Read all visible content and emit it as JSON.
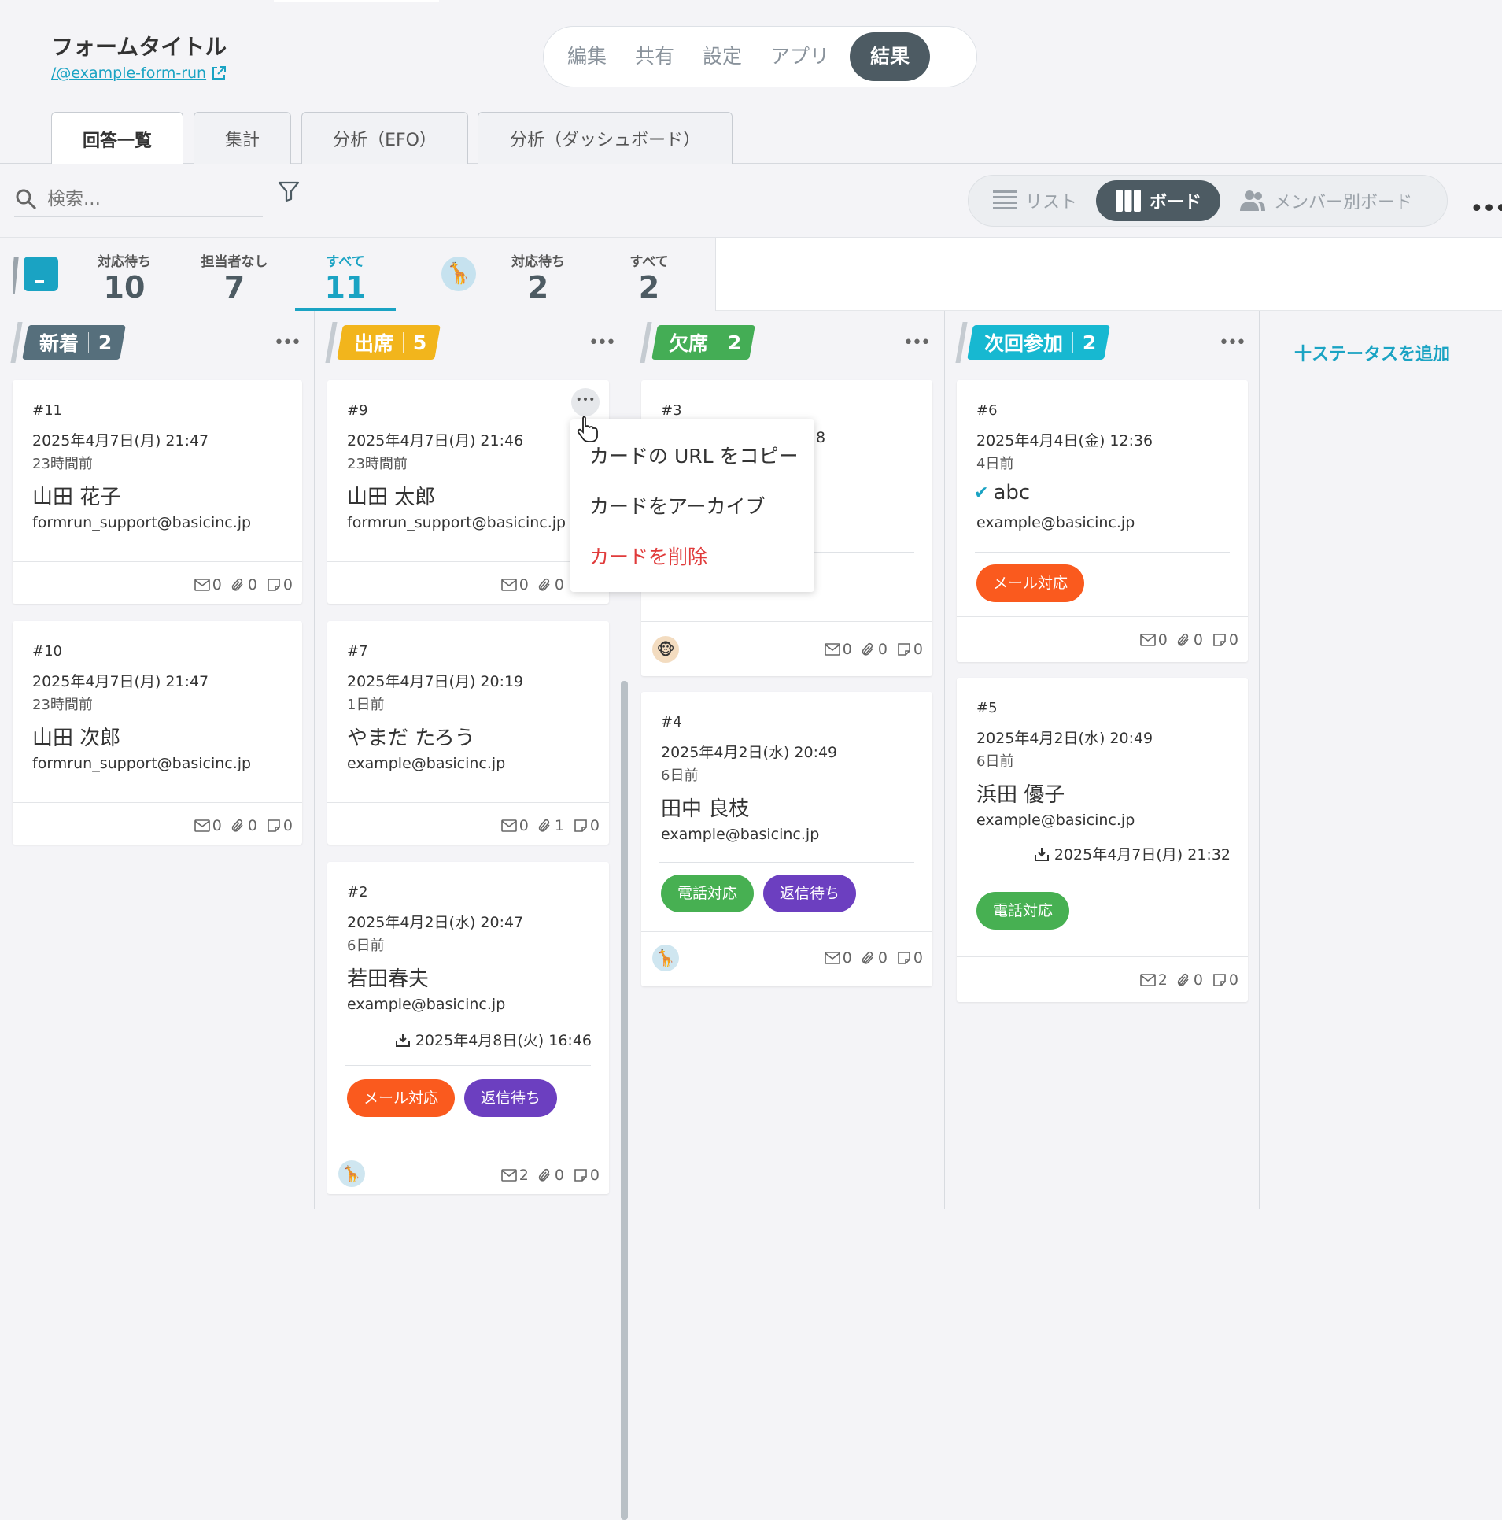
{
  "header": {
    "title": "フォームタイトル",
    "link": "/@example-form-run",
    "nav": [
      "編集",
      "共有",
      "設定",
      "アプリ",
      "結果"
    ],
    "nav_active": "結果"
  },
  "tabs": [
    "回答一覧",
    "集計",
    "分析（EFO）",
    "分析（ダッシュボード）"
  ],
  "toolbar": {
    "search_placeholder": "検索...",
    "views": [
      "リスト",
      "ボード",
      "メンバー別ボード"
    ],
    "view_active": "ボード"
  },
  "stats": {
    "team": [
      {
        "label": "対応待ち",
        "value": "10"
      },
      {
        "label": "担当者なし",
        "value": "7"
      },
      {
        "label": "すべて",
        "value": "11"
      }
    ],
    "member": [
      {
        "label": "対応待ち",
        "value": "2"
      },
      {
        "label": "すべて",
        "value": "2"
      }
    ]
  },
  "columns": [
    {
      "name": "新着",
      "count": "2",
      "color": "#566f7c"
    },
    {
      "name": "出席",
      "count": "5",
      "color": "#f2b51c"
    },
    {
      "name": "欠席",
      "count": "2",
      "color": "#44ad55"
    },
    {
      "name": "次回参加",
      "count": "2",
      "color": "#17b8d1"
    }
  ],
  "add_status": "十ステータスを追加",
  "cards": {
    "c11": {
      "no": "#11",
      "date": "2025年4月7日(月) 21:47",
      "ago": "23時間前",
      "name": "山田 花子",
      "email": "formrun_support@basicinc.jp",
      "mail": "0",
      "clip": "0",
      "memo": "0"
    },
    "c10": {
      "no": "#10",
      "date": "2025年4月7日(月) 21:47",
      "ago": "23時間前",
      "name": "山田 次郎",
      "email": "formrun_support@basicinc.jp",
      "mail": "0",
      "clip": "0",
      "memo": "0"
    },
    "c9": {
      "no": "#9",
      "date": "2025年4月7日(月) 21:46",
      "ago": "23時間前",
      "name": "山田 太郎",
      "email": "formrun_support@basicinc.jp",
      "mail": "0",
      "clip": "0",
      "memo": "0"
    },
    "c7": {
      "no": "#7",
      "date": "2025年4月7日(月) 20:19",
      "ago": "1日前",
      "name": "やまだ たろう",
      "email": "example@basicinc.jp",
      "mail": "0",
      "clip": "1",
      "memo": "0"
    },
    "c2": {
      "no": "#2",
      "date": "2025年4月2日(水) 20:47",
      "ago": "6日前",
      "name": "若田春夫",
      "email": "example@basicinc.jp",
      "received": "2025年4月8日(火) 16:46",
      "tags": [
        "メール対応",
        "返信待ち"
      ],
      "mail": "2",
      "clip": "0",
      "memo": "0"
    },
    "c3": {
      "no": "#3",
      "date_tail": "8",
      "mail": "0",
      "clip": "0",
      "memo": "0"
    },
    "c4": {
      "no": "#4",
      "date": "2025年4月2日(水) 20:49",
      "ago": "6日前",
      "name": "田中 良枝",
      "email": "example@basicinc.jp",
      "tags": [
        "電話対応",
        "返信待ち"
      ],
      "mail": "0",
      "clip": "0",
      "memo": "0"
    },
    "c6": {
      "no": "#6",
      "date": "2025年4月4日(金) 12:36",
      "ago": "4日前",
      "name": "abc",
      "email": "example@basicinc.jp",
      "tags": [
        "メール対応"
      ],
      "mail": "0",
      "clip": "0",
      "memo": "0"
    },
    "c5": {
      "no": "#5",
      "date": "2025年4月2日(水) 20:49",
      "ago": "6日前",
      "name": "浜田 優子",
      "email": "example@basicinc.jp",
      "received": "2025年4月7日(月) 21:32",
      "tags": [
        "電話対応"
      ],
      "mail": "2",
      "clip": "0",
      "memo": "0"
    }
  },
  "tag_colors": {
    "メール対応": "#fa5a1e",
    "返信待ち": "#6c3fc0",
    "電話対応": "#47b052"
  },
  "context_menu": [
    "カードの URL をコピー",
    "カードをアーカイブ",
    "カードを削除"
  ],
  "colors": {
    "accent": "#1aa3c3",
    "dark": "#4d5b63",
    "danger": "#e03b3b"
  }
}
